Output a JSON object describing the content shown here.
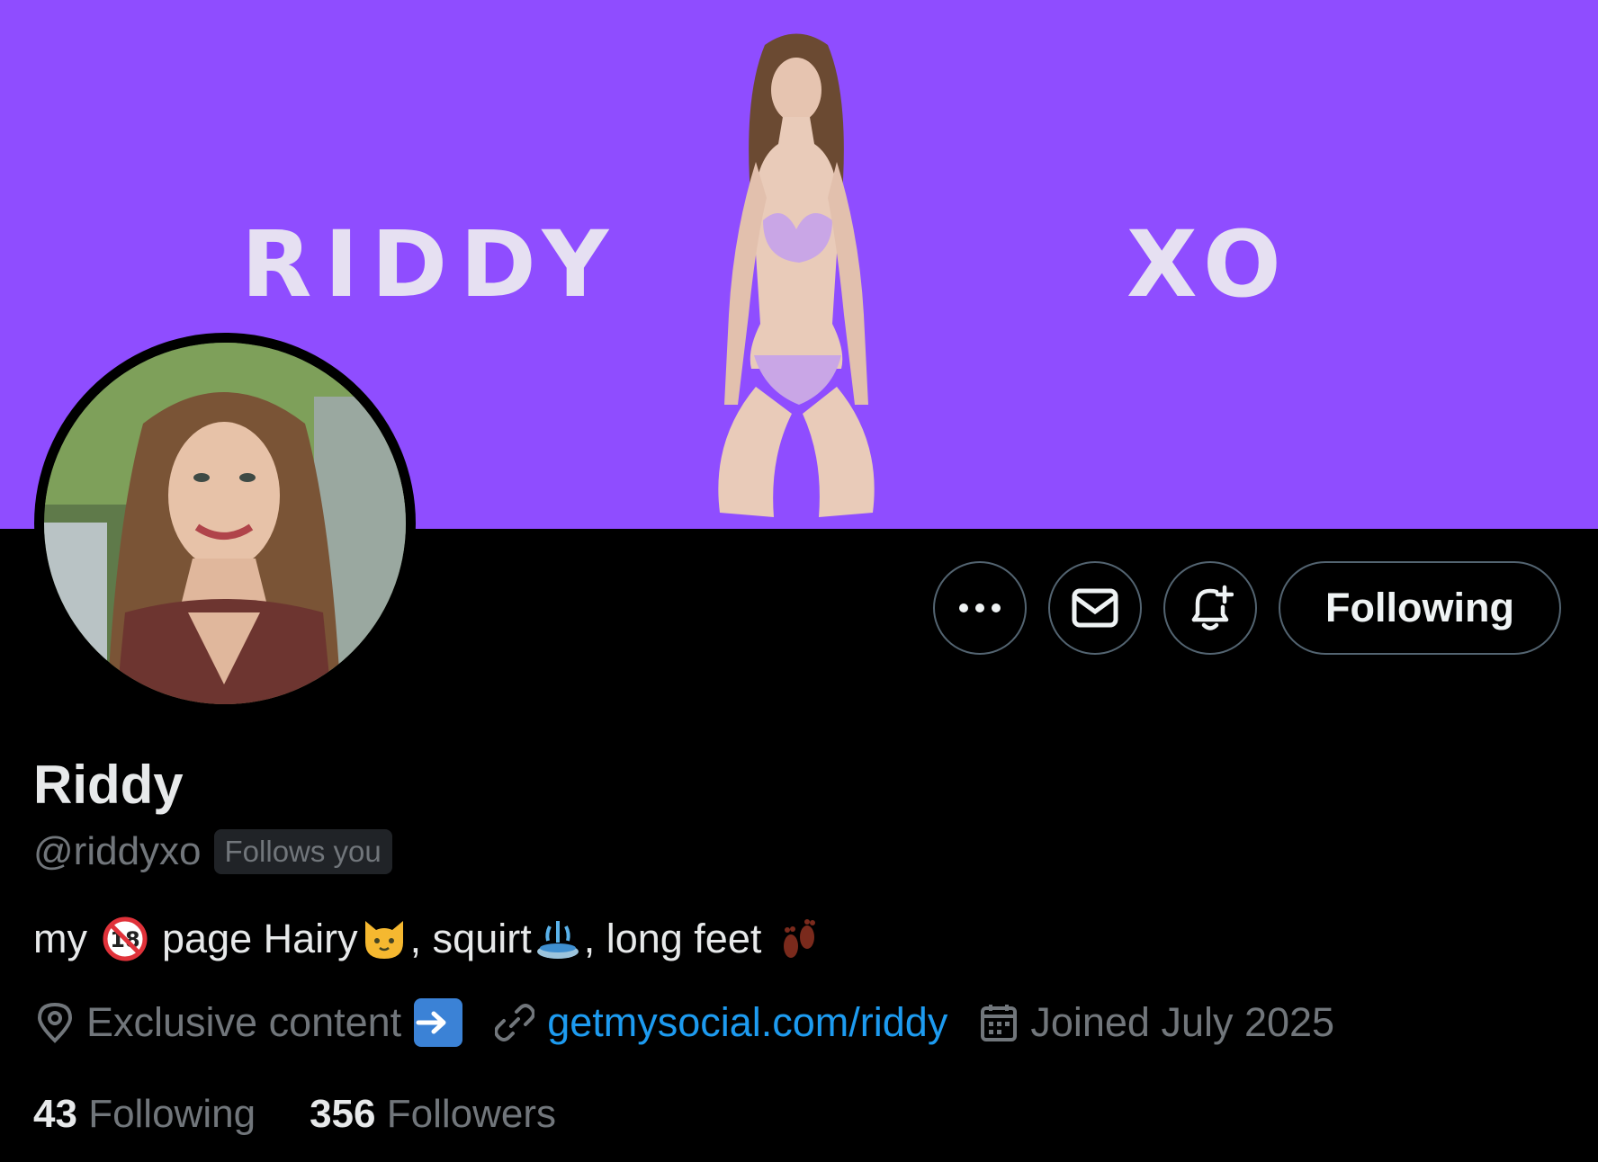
{
  "banner": {
    "left_text": "RIDDY",
    "right_text": "XO",
    "bg_color": "#8f4dff"
  },
  "profile": {
    "name": "Riddy",
    "handle": "@riddyxo",
    "follows_badge": "Follows you",
    "bio": {
      "parts": [
        "my",
        "page Hairy",
        ", squirt",
        ", long feet"
      ],
      "emoji_icons": [
        "no-under-18-icon",
        "cat-icon",
        "fountain-icon",
        "footprints-icon"
      ]
    },
    "location": "Exclusive content",
    "link": "getmysocial.com/riddy",
    "joined": "Joined July 2025",
    "following_count": "43",
    "following_label": "Following",
    "followers_count": "356",
    "followers_label": "Followers"
  },
  "actions": {
    "more_icon": "more-icon",
    "message_icon": "envelope-icon",
    "notify_icon": "bell-plus-icon",
    "following_button": "Following"
  },
  "colors": {
    "link": "#1d9bf0",
    "muted": "#71767b",
    "background": "#000000"
  }
}
